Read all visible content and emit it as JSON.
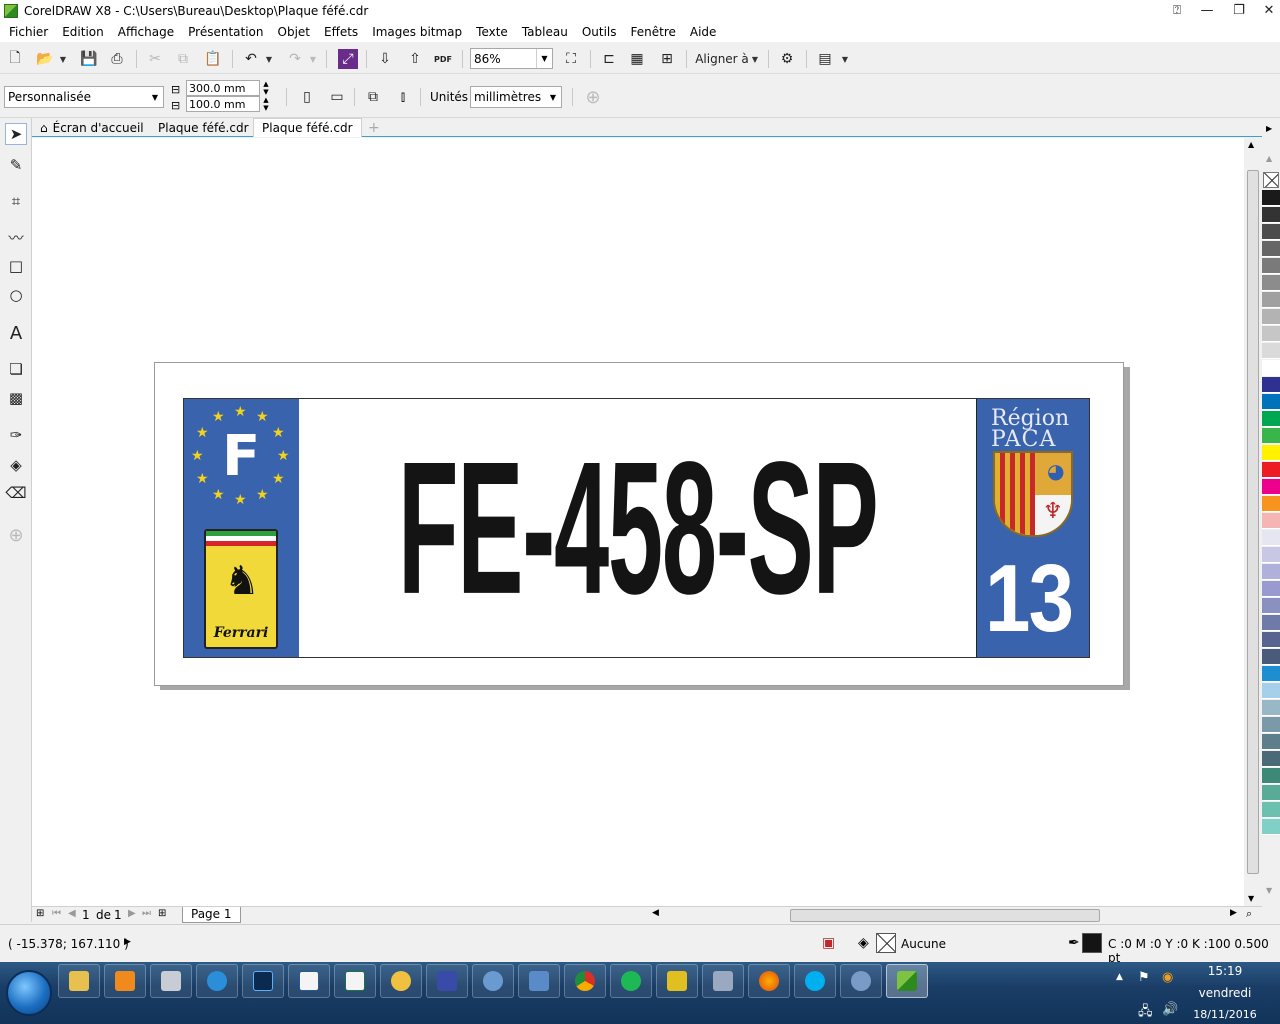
{
  "window": {
    "title": "CorelDRAW X8 - C:\\Users\\Bureau\\Desktop\\Plaque féfé.cdr",
    "minimize_icon": "minimize-icon",
    "restore_icon": "restore-icon",
    "close_icon": "close-icon"
  },
  "menu": [
    "Fichier",
    "Edition",
    "Affichage",
    "Présentation",
    "Objet",
    "Effets",
    "Images bitmap",
    "Texte",
    "Tableau",
    "Outils",
    "Fenêtre",
    "Aide"
  ],
  "toolbar": {
    "zoom": "86%",
    "align_label": "Aligner à",
    "pdf_label": "PDF"
  },
  "property_bar": {
    "page_size": "Personnalisée",
    "width": "300.0 mm",
    "height": "100.0 mm",
    "units_label": "Unités :",
    "units_value": "millimètres"
  },
  "tabs": [
    {
      "label": "Écran d'accueil",
      "icon": "home-icon"
    },
    {
      "label": "Plaque féfé.cdr"
    },
    {
      "label": "Plaque féfé.cdr",
      "active": true
    }
  ],
  "plate": {
    "number": "FE-458-SP",
    "country_letter": "F",
    "badge_text": "Ferrari",
    "region_line1": "Région",
    "region_line2": "PACA",
    "department": "13",
    "colors": {
      "band": "#3a63ad",
      "text": "#141414",
      "stars": "#f3d21a"
    }
  },
  "page_nav": {
    "current": "1",
    "of_label": "de",
    "total": "1",
    "page_tab": "Page 1"
  },
  "status": {
    "coordinates": "( -15.378; 167.110 )",
    "fill_label": "Aucune",
    "outline_info": "C :0 M :0 Y :0 K :100  0.500 pt"
  },
  "palette": [
    "#1a1a1a",
    "#333333",
    "#4d4d4d",
    "#666666",
    "#7a7a7a",
    "#8c8c8c",
    "#a0a0a0",
    "#b3b3b3",
    "#c6c6c6",
    "#dadada",
    "#ffffff",
    "#2e3192",
    "#0072bc",
    "#00a651",
    "#39b54a",
    "#fff200",
    "#ed1c24",
    "#ec008c",
    "#f7941d",
    "#f5b5b5",
    "#e6e6f2",
    "#c8c8e6",
    "#b0b0dc",
    "#9a9ad0",
    "#8a90c0",
    "#6f7aa8",
    "#56648f",
    "#4a5a7a",
    "#1d8fd0",
    "#a6d0ea",
    "#98b8c8",
    "#7a9aaa",
    "#5e7e8c",
    "#4a6a78",
    "#3e8878",
    "#5aaa98",
    "#6cc0b0",
    "#80d0c8"
  ],
  "taskbar": {
    "time": "15:19",
    "day": "vendredi",
    "date": "18/11/2016"
  }
}
